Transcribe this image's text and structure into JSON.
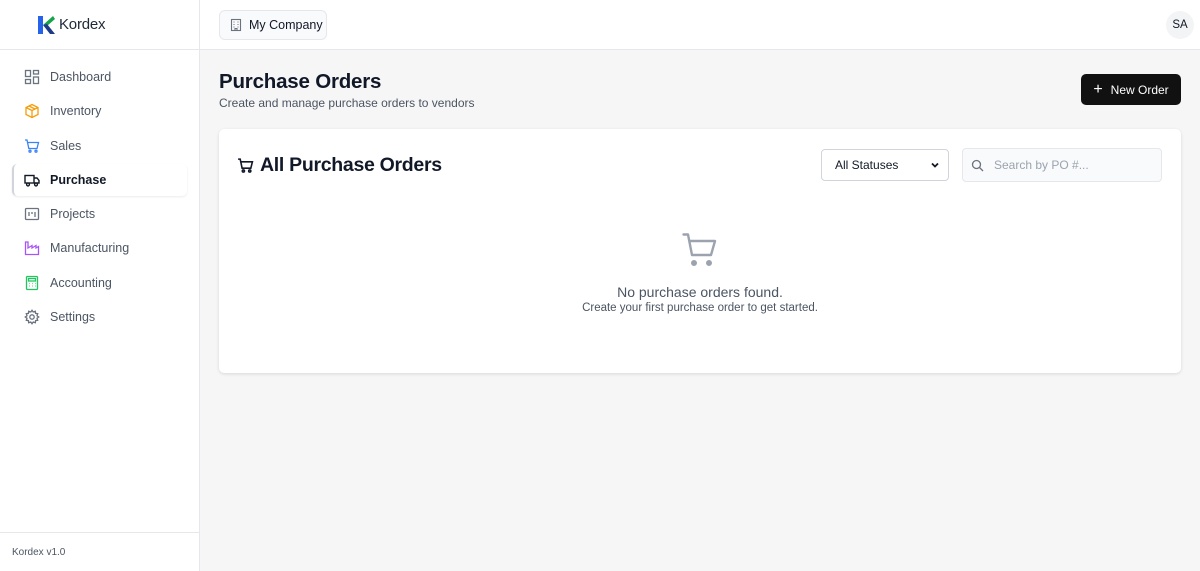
{
  "app": {
    "name": "Kordex",
    "version": "Kordex v1.0",
    "brand_colors": {
      "primary": "#2563eb",
      "accent": "#16a34a"
    }
  },
  "sidebar": {
    "items": [
      {
        "label": "Dashboard",
        "icon": "dashboard-icon",
        "active": false
      },
      {
        "label": "Inventory",
        "icon": "box-icon",
        "active": false
      },
      {
        "label": "Sales",
        "icon": "cart-icon",
        "active": false
      },
      {
        "label": "Purchase",
        "icon": "truck-icon",
        "active": true
      },
      {
        "label": "Projects",
        "icon": "kanban-icon",
        "active": false
      },
      {
        "label": "Manufacturing",
        "icon": "factory-icon",
        "active": false
      },
      {
        "label": "Accounting",
        "icon": "calculator-icon",
        "active": false
      },
      {
        "label": "Settings",
        "icon": "gear-icon",
        "active": false
      }
    ]
  },
  "topbar": {
    "company": "My Company",
    "avatar_initials": "SA"
  },
  "page": {
    "title": "Purchase Orders",
    "subtitle": "Create and manage purchase orders to vendors",
    "new_order_label": "New Order"
  },
  "card": {
    "title": "All Purchase Orders",
    "status_filter": {
      "selected": "All Statuses"
    },
    "search": {
      "placeholder": "Search by PO #...",
      "value": ""
    },
    "empty": {
      "title": "No purchase orders found.",
      "subtitle": "Create your first purchase order to get started."
    }
  }
}
